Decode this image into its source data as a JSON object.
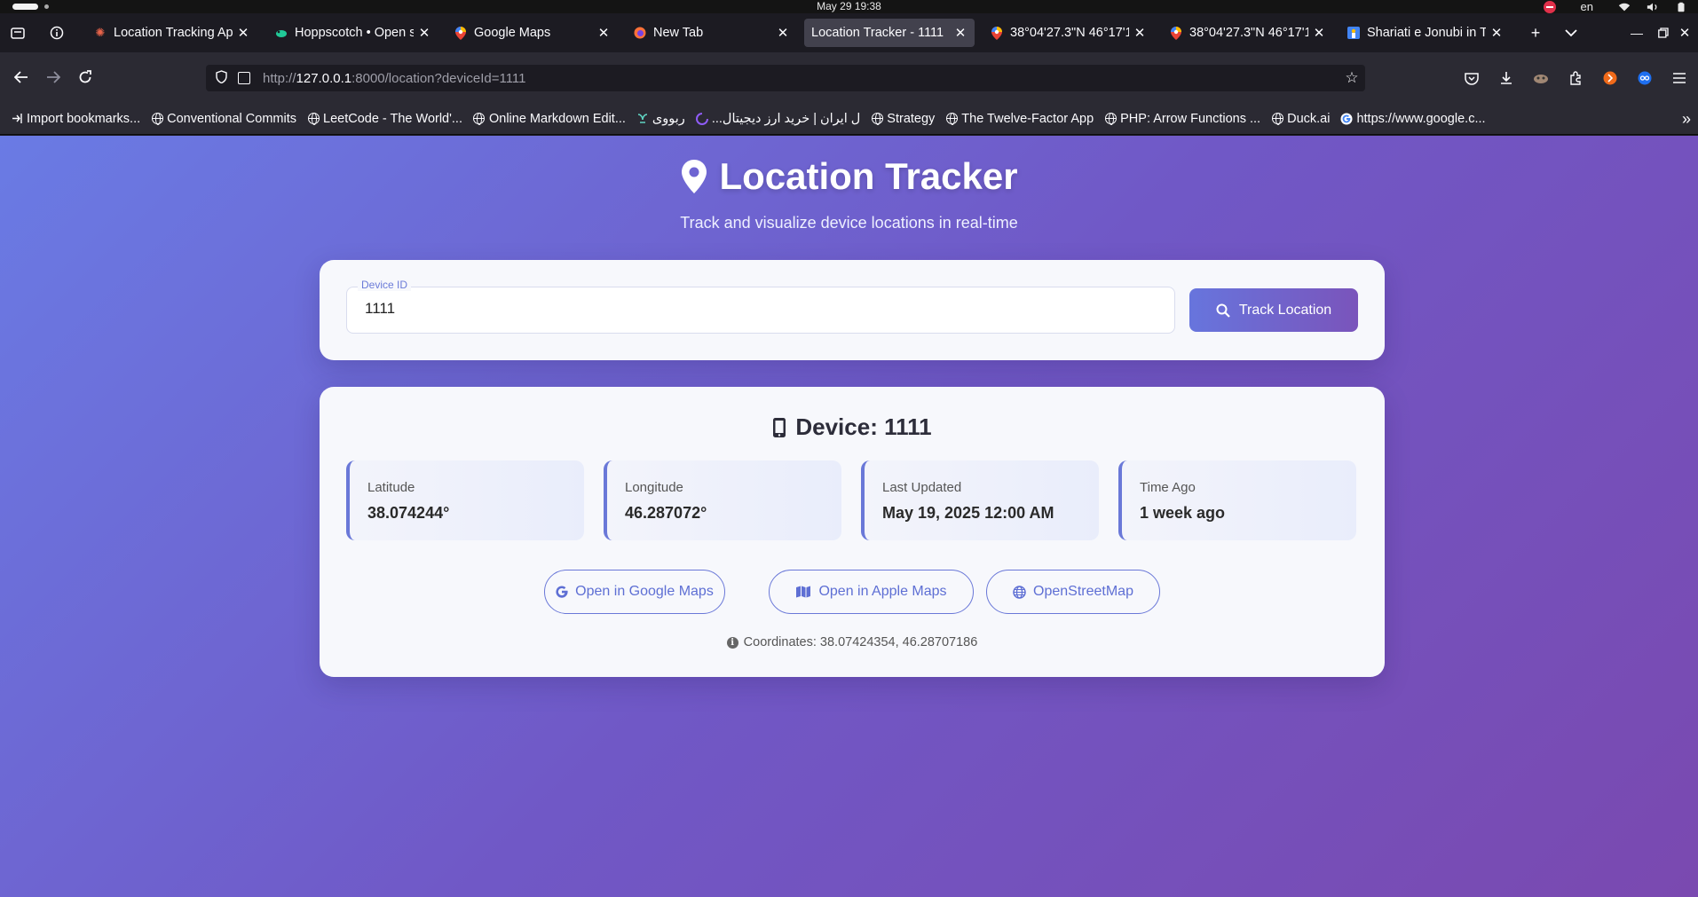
{
  "os": {
    "clock": "May 29  19:38",
    "language": "en"
  },
  "browser": {
    "tabs": [
      {
        "label": "Location Tracking App",
        "icon": "sparkle-icon",
        "color": "#e9644a",
        "active": false
      },
      {
        "label": "Hoppscotch • Open so",
        "icon": "hoppscotch-icon",
        "color": "#20c997",
        "active": false
      },
      {
        "label": "Google Maps",
        "icon": "map-pin-icon",
        "color": "#34a853",
        "active": false
      },
      {
        "label": "New Tab",
        "icon": "firefox-icon",
        "color": "#ff7139",
        "active": false
      },
      {
        "label": "Location Tracker - 1111",
        "icon": "none",
        "color": "",
        "active": true
      },
      {
        "label": "38°04'27.3\"N 46°17'1",
        "icon": "map-pin-icon",
        "color": "#34a853",
        "active": false
      },
      {
        "label": "38°04'27.3\"N 46°17'1",
        "icon": "map-pin-icon",
        "color": "#34a853",
        "active": false
      },
      {
        "label": "Shariati e Jonubi in Ta",
        "icon": "street-icon",
        "color": "#4285f4",
        "active": false
      }
    ],
    "url_host": "127.0.0.1",
    "url_rest": ":8000/location?deviceId=1111",
    "url_prefix": "http://",
    "bookmarks": [
      {
        "label": "Import bookmarks...",
        "icon": "import-icon"
      },
      {
        "label": "Conventional Commits",
        "icon": "globe-icon"
      },
      {
        "label": "LeetCode - The World'...",
        "icon": "globe-icon"
      },
      {
        "label": "Online Markdown Edit...",
        "icon": "globe-icon"
      },
      {
        "label": "ربووی",
        "icon": "robovi-icon"
      },
      {
        "label": "...ل ایران | خرید ارز دیجیتال",
        "icon": "crypto-icon"
      },
      {
        "label": "Strategy",
        "icon": "globe-icon"
      },
      {
        "label": "The Twelve-Factor App",
        "icon": "globe-icon"
      },
      {
        "label": "PHP: Arrow Functions ...",
        "icon": "globe-icon"
      },
      {
        "label": "Duck.ai",
        "icon": "globe-icon"
      },
      {
        "label": "https://www.google.c...",
        "icon": "google-icon"
      }
    ]
  },
  "app": {
    "title": "Location Tracker",
    "subtitle": "Track and visualize device locations in real-time",
    "search": {
      "label": "Device ID",
      "value": "1111",
      "button": "Track Location"
    },
    "device": {
      "title": "Device: 1111",
      "stats": [
        {
          "label": "Latitude",
          "value": "38.074244°"
        },
        {
          "label": "Longitude",
          "value": "46.287072°"
        },
        {
          "label": "Last Updated",
          "value": "May 19, 2025 12:00 AM"
        },
        {
          "label": "Time Ago",
          "value": "1 week ago"
        }
      ],
      "buttons": {
        "google": "Open in Google Maps",
        "apple": "Open in Apple Maps",
        "osm": "OpenStreetMap"
      },
      "coordinates": "Coordinates: 38.07424354, 46.28707186"
    },
    "colors": {
      "accent": "#6a78d8",
      "gradient_start": "#6a7be4",
      "gradient_end": "#7a49b0"
    }
  }
}
